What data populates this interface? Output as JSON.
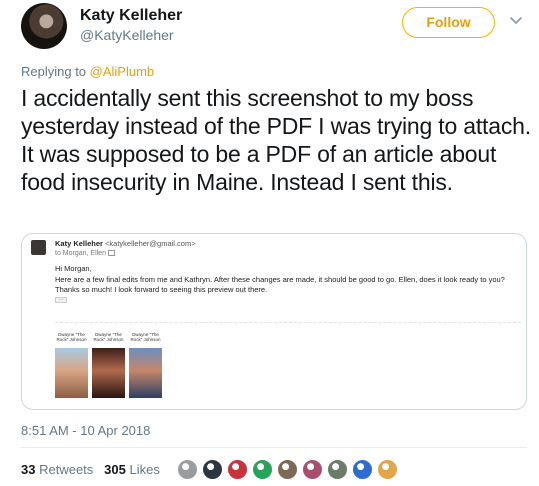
{
  "author": {
    "name": "Katy Kelleher",
    "handle": "@KatyKelleher"
  },
  "follow_label": "Follow",
  "replying": {
    "prefix": "Replying to ",
    "mention": "@AliPlumb"
  },
  "tweet_text": "I accidentally sent this screenshot to my boss yesterday instead of the PDF I was trying to attach. It was supposed to be a PDF of an article about food insecurity in Maine. Instead I sent this.",
  "email": {
    "sender_name": "Katy Kelleher",
    "sender_email": "<katykelleher@gmail.com>",
    "to_line": "to Morgan, Ellen",
    "greeting": "Hi Morgan,",
    "body": "Here are a few final edits from me and Kathryn. After these changes are made, it should be good to go. Ellen, does it look ready to you?",
    "closing": "Thanks so much! I look forward to seeing this preview out there.",
    "ellipsis": "...",
    "attachments": [
      {
        "caption": "Dwayne \"The Rock\" Johnson"
      },
      {
        "caption": "Dwayne \"The Rock\" Johnson"
      },
      {
        "caption": "Dwayne \"The Rock\" Johnson"
      }
    ]
  },
  "timestamp": "8:51 AM - 10 Apr 2018",
  "stats": {
    "retweets": "33",
    "retweets_label": "Retweets",
    "likes": "305",
    "likes_label": "Likes"
  },
  "likers": [
    {
      "icon": "user-avatar",
      "color": "#9a9d9f"
    },
    {
      "icon": "user-avatar",
      "color": "#2d3640"
    },
    {
      "icon": "user-avatar",
      "color": "#c8323a"
    },
    {
      "icon": "user-avatar",
      "color": "#27a35c"
    },
    {
      "icon": "user-avatar",
      "color": "#7d6a55"
    },
    {
      "icon": "user-avatar",
      "color": "#a94f6e"
    },
    {
      "icon": "user-avatar",
      "color": "#6b7c6a"
    },
    {
      "icon": "user-avatar",
      "color": "#2e6cd1"
    },
    {
      "icon": "user-avatar",
      "color": "#e2a54a"
    }
  ]
}
